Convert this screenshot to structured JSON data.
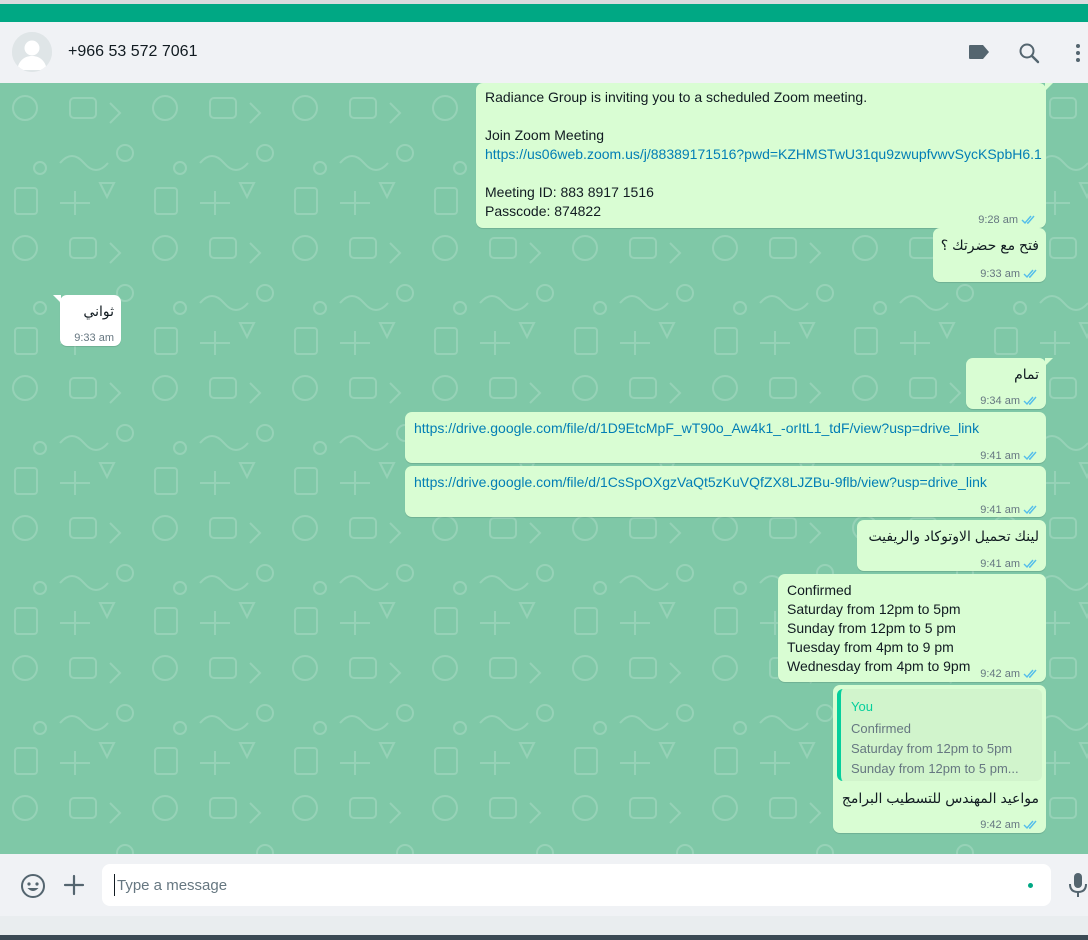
{
  "header": {
    "contact_name": "+966 53 572 7061",
    "icons": [
      "label-icon",
      "search-icon",
      "menu-icon"
    ]
  },
  "messages": [
    {
      "direction": "outgoing",
      "lines": [
        "Radiance Group is inviting you to a scheduled Zoom meeting.",
        "",
        "Join Zoom Meeting"
      ],
      "link": "https://us06web.zoom.us/j/88389171516?pwd=KZHMSTwU31qu9zwupfvwvSycKSpbH6.1",
      "lines_after": [
        "Meeting ID: 883 8917 1516",
        "Passcode: 874822"
      ],
      "time": "9:28 am",
      "status": "read"
    },
    {
      "direction": "outgoing",
      "text": "فتح مع حضرتك ؟",
      "time": "9:33 am",
      "status": "read"
    },
    {
      "direction": "incoming",
      "text": "ثواني",
      "time": "9:33 am"
    },
    {
      "direction": "outgoing",
      "text": "تمام",
      "time": "9:34 am",
      "status": "read"
    },
    {
      "direction": "outgoing",
      "link": "https://drive.google.com/file/d/1D9EtcMpF_wT90o_Aw4k1_-orItL1_tdF/view?usp=drive_link",
      "time": "9:41 am",
      "status": "read"
    },
    {
      "direction": "outgoing",
      "link": "https://drive.google.com/file/d/1CsSpOXgzVaQt5zKuVQfZX8LJZBu-9flb/view?usp=drive_link",
      "time": "9:41 am",
      "status": "read"
    },
    {
      "direction": "outgoing",
      "text": "لينك تحميل الاوتوكاد والريفيت",
      "time": "9:41 am",
      "status": "read"
    },
    {
      "direction": "outgoing",
      "lines": [
        "Confirmed",
        "Saturday from 12pm to 5pm",
        "Sunday from 12pm to 5 pm",
        "Tuesday from 4pm to 9 pm",
        "Wednesday from 4pm to 9pm"
      ],
      "time": "9:42 am",
      "status": "read"
    },
    {
      "direction": "outgoing",
      "quote": {
        "author": "You",
        "lines": [
          "Confirmed",
          "Saturday from 12pm to 5pm",
          "Sunday from 12pm to 5 pm..."
        ]
      },
      "text": "مواعيد المهندس للتسطيب البرامج",
      "time": "9:42 am",
      "status": "read"
    }
  ],
  "composer": {
    "placeholder": "Type a message",
    "icons": [
      "emoji-icon",
      "attach-plus-icon",
      "microphone-icon"
    ]
  },
  "colors": {
    "accent": "#00a884",
    "outgoing_bubble": "#d9fdd3",
    "incoming_bubble": "#ffffff",
    "chat_background": "#7fc8a7",
    "link": "#027eb5",
    "read_ticks": "#53bdeb"
  }
}
